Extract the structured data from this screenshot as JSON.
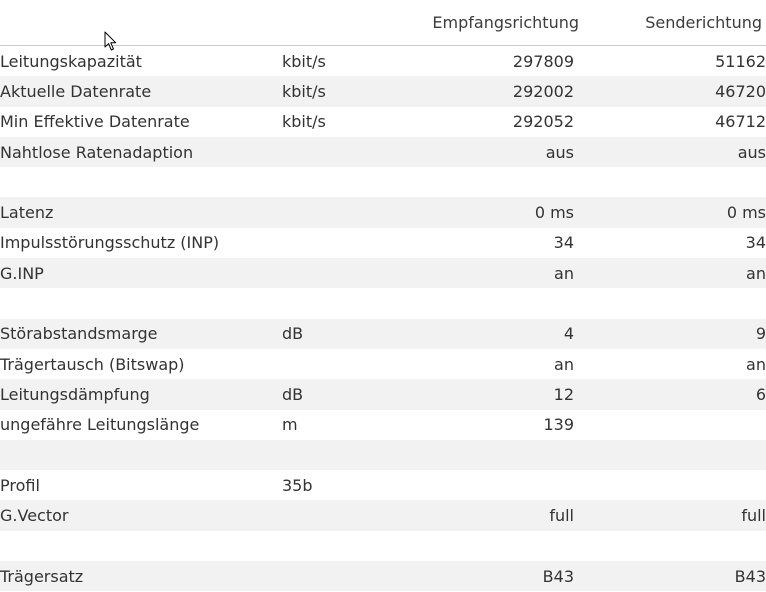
{
  "header": {
    "downstream": "Empfangsrichtung",
    "upstream": "Senderichtung"
  },
  "rows": [
    {
      "label": "Leitungskapazität",
      "unit": "kbit/s",
      "down": "297809",
      "up": "51162"
    },
    {
      "label": "Aktuelle Datenrate",
      "unit": "kbit/s",
      "down": "292002",
      "up": "46720"
    },
    {
      "label": "Min Effektive Datenrate",
      "unit": "kbit/s",
      "down": "292052",
      "up": "46712"
    },
    {
      "label": "Nahtlose Ratenadaption",
      "unit": "",
      "down": "aus",
      "up": "aus"
    },
    {
      "label": "",
      "unit": "",
      "down": "",
      "up": ""
    },
    {
      "label": "Latenz",
      "unit": "",
      "down": "0 ms",
      "up": "0 ms"
    },
    {
      "label": "Impulsstörungsschutz (INP)",
      "unit": "",
      "down": "34",
      "up": "34"
    },
    {
      "label": "G.INP",
      "unit": "",
      "down": "an",
      "up": "an"
    },
    {
      "label": "",
      "unit": "",
      "down": "",
      "up": ""
    },
    {
      "label": "Störabstandsmarge",
      "unit": "dB",
      "down": "4",
      "up": "9"
    },
    {
      "label": "Trägertausch (Bitswap)",
      "unit": "",
      "down": "an",
      "up": "an"
    },
    {
      "label": "Leitungsdämpfung",
      "unit": "dB",
      "down": "12",
      "up": "6"
    },
    {
      "label": "ungefähre Leitungslänge",
      "unit": "m",
      "down": "139",
      "up": ""
    },
    {
      "label": "",
      "unit": "",
      "down": "",
      "up": ""
    },
    {
      "label": "Profil",
      "unit": "35b",
      "down": "",
      "up": ""
    },
    {
      "label": "G.Vector",
      "unit": "",
      "down": "full",
      "up": "full"
    },
    {
      "label": "",
      "unit": "",
      "down": "",
      "up": ""
    },
    {
      "label": "Trägersatz",
      "unit": "",
      "down": "B43",
      "up": "B43"
    }
  ]
}
